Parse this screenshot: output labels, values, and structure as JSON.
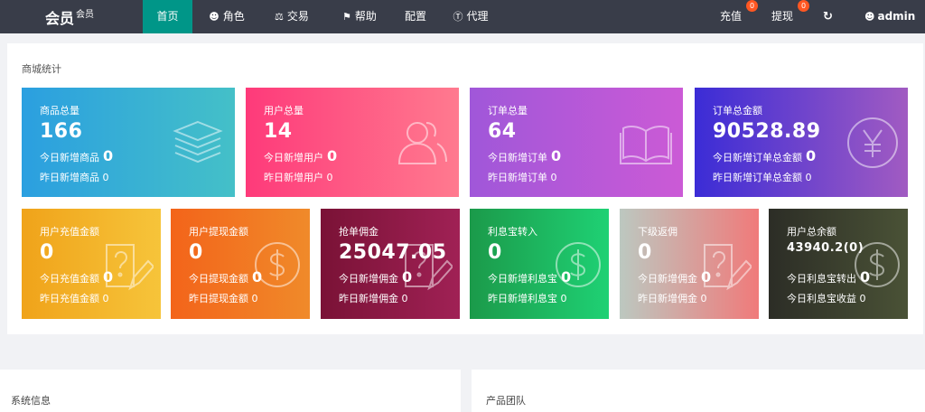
{
  "brand": {
    "title": "会员",
    "subtitle": "会员"
  },
  "nav": [
    {
      "label": "首页",
      "icon": ""
    },
    {
      "label": "角色",
      "icon": "user-icon"
    },
    {
      "label": "交易",
      "icon": "scale-icon"
    },
    {
      "label": "帮助",
      "icon": "flag-icon"
    },
    {
      "label": "配置",
      "icon": ""
    },
    {
      "label": "代理",
      "icon": "dollar-circle-icon"
    }
  ],
  "header_right": {
    "recharge": {
      "label": "充值",
      "badge": "0"
    },
    "withdraw": {
      "label": "提现",
      "badge": "0"
    },
    "refresh_icon": "refresh-icon",
    "user": "admin"
  },
  "panel": {
    "title": "商城统计"
  },
  "cards_top": [
    {
      "title": "商品总量",
      "value": "166",
      "row1_label": "今日新增商品",
      "row1_value": "0",
      "row2": "昨日新增商品 0",
      "icon": "layers-icon",
      "colors": [
        "#2b9fe0",
        "#44c0c8"
      ]
    },
    {
      "title": "用户总量",
      "value": "14",
      "row1_label": "今日新增用户",
      "row1_value": "0",
      "row2": "昨日新增用户 0",
      "icon": "users-icon",
      "colors": [
        "#fe3a7a",
        "#ff7a8f"
      ]
    },
    {
      "title": "订单总量",
      "value": "64",
      "row1_label": "今日新增订单",
      "row1_value": "0",
      "row2": "昨日新增订单 0",
      "icon": "book-icon",
      "colors": [
        "#a057d9",
        "#cb5ad6"
      ]
    },
    {
      "title": "订单总金额",
      "value": "90528.89",
      "row1_label": "今日新增订单总金额",
      "row1_value": "0",
      "row2": "昨日新增订单总金额 0",
      "icon": "yen-circle-icon",
      "colors": [
        "#3b2cd6",
        "#a15bc2"
      ]
    }
  ],
  "cards_bottom": [
    {
      "title": "用户充值金额",
      "value": "0",
      "row1_label": "今日充值金额",
      "row1_value": "0",
      "row2": "昨日充值金额 0",
      "icon": "question-edit-icon",
      "colors": [
        "#f0a31a",
        "#f6c43a"
      ]
    },
    {
      "title": "用户提现金额",
      "value": "0",
      "row1_label": "今日提现金额",
      "row1_value": "0",
      "row2": "昨日提现金额 0",
      "icon": "dollar-circle-icon",
      "colors": [
        "#f3641a",
        "#f08a2a"
      ]
    },
    {
      "title": "抢单佣金",
      "value": "25047.05",
      "row1_label": "今日新增佣金",
      "row1_value": "0",
      "row2": "昨日新增佣金 0",
      "icon": "question-edit-icon",
      "colors": [
        "#7a1236",
        "#a02155"
      ]
    },
    {
      "title": "利息宝转入",
      "value": "0",
      "row1_label": "今日新增利息宝",
      "row1_value": "0",
      "row2": "昨日新增利息宝 0",
      "icon": "dollar-circle-icon",
      "colors": [
        "#1b9a4a",
        "#1fd174"
      ]
    },
    {
      "title": "下级返佣",
      "value": "0",
      "row1_label": "今日新增佣金",
      "row1_value": "0",
      "row2": "昨日新增佣金 0",
      "icon": "question-edit-icon",
      "colors": [
        "#bcc8c0",
        "#f07a7a"
      ]
    },
    {
      "title": "用户总余额",
      "value": "43940.2(0)",
      "row1_label": "今日利息宝转出",
      "row1_value": "0",
      "row2": "今日利息宝收益 0",
      "icon": "dollar-circle-icon",
      "colors": [
        "#2c2d26",
        "#4a5236"
      ]
    }
  ],
  "bottom_panels": [
    {
      "title": "系统信息"
    },
    {
      "title": "产品团队"
    }
  ]
}
